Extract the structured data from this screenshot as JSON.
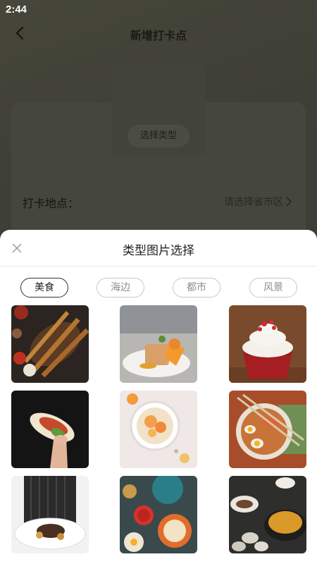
{
  "status_bar": {
    "time": "2:44"
  },
  "nav": {
    "title": "新增打卡点",
    "back_icon": "chevron-left-icon"
  },
  "form": {
    "type_button": "选择类型",
    "location_label": "打卡地点：",
    "location_placeholder": "请选择省市区",
    "location_chevron": "chevron-right-icon"
  },
  "sheet": {
    "title": "类型图片选择",
    "close_icon": "close-icon",
    "tabs": [
      {
        "label": "美食",
        "active": true
      },
      {
        "label": "海边",
        "active": false
      },
      {
        "label": "都市",
        "active": false
      },
      {
        "label": "风景",
        "active": false
      }
    ],
    "photos": [
      "grilled-skewers-platter",
      "plated-dessert-oranges",
      "red-velvet-cupcake",
      "taco-in-hand",
      "fruit-granola-bowl",
      "ramen-egg-bowl",
      "chef-plated-dish",
      "table-spread-dishes",
      "soup-and-clams"
    ]
  }
}
